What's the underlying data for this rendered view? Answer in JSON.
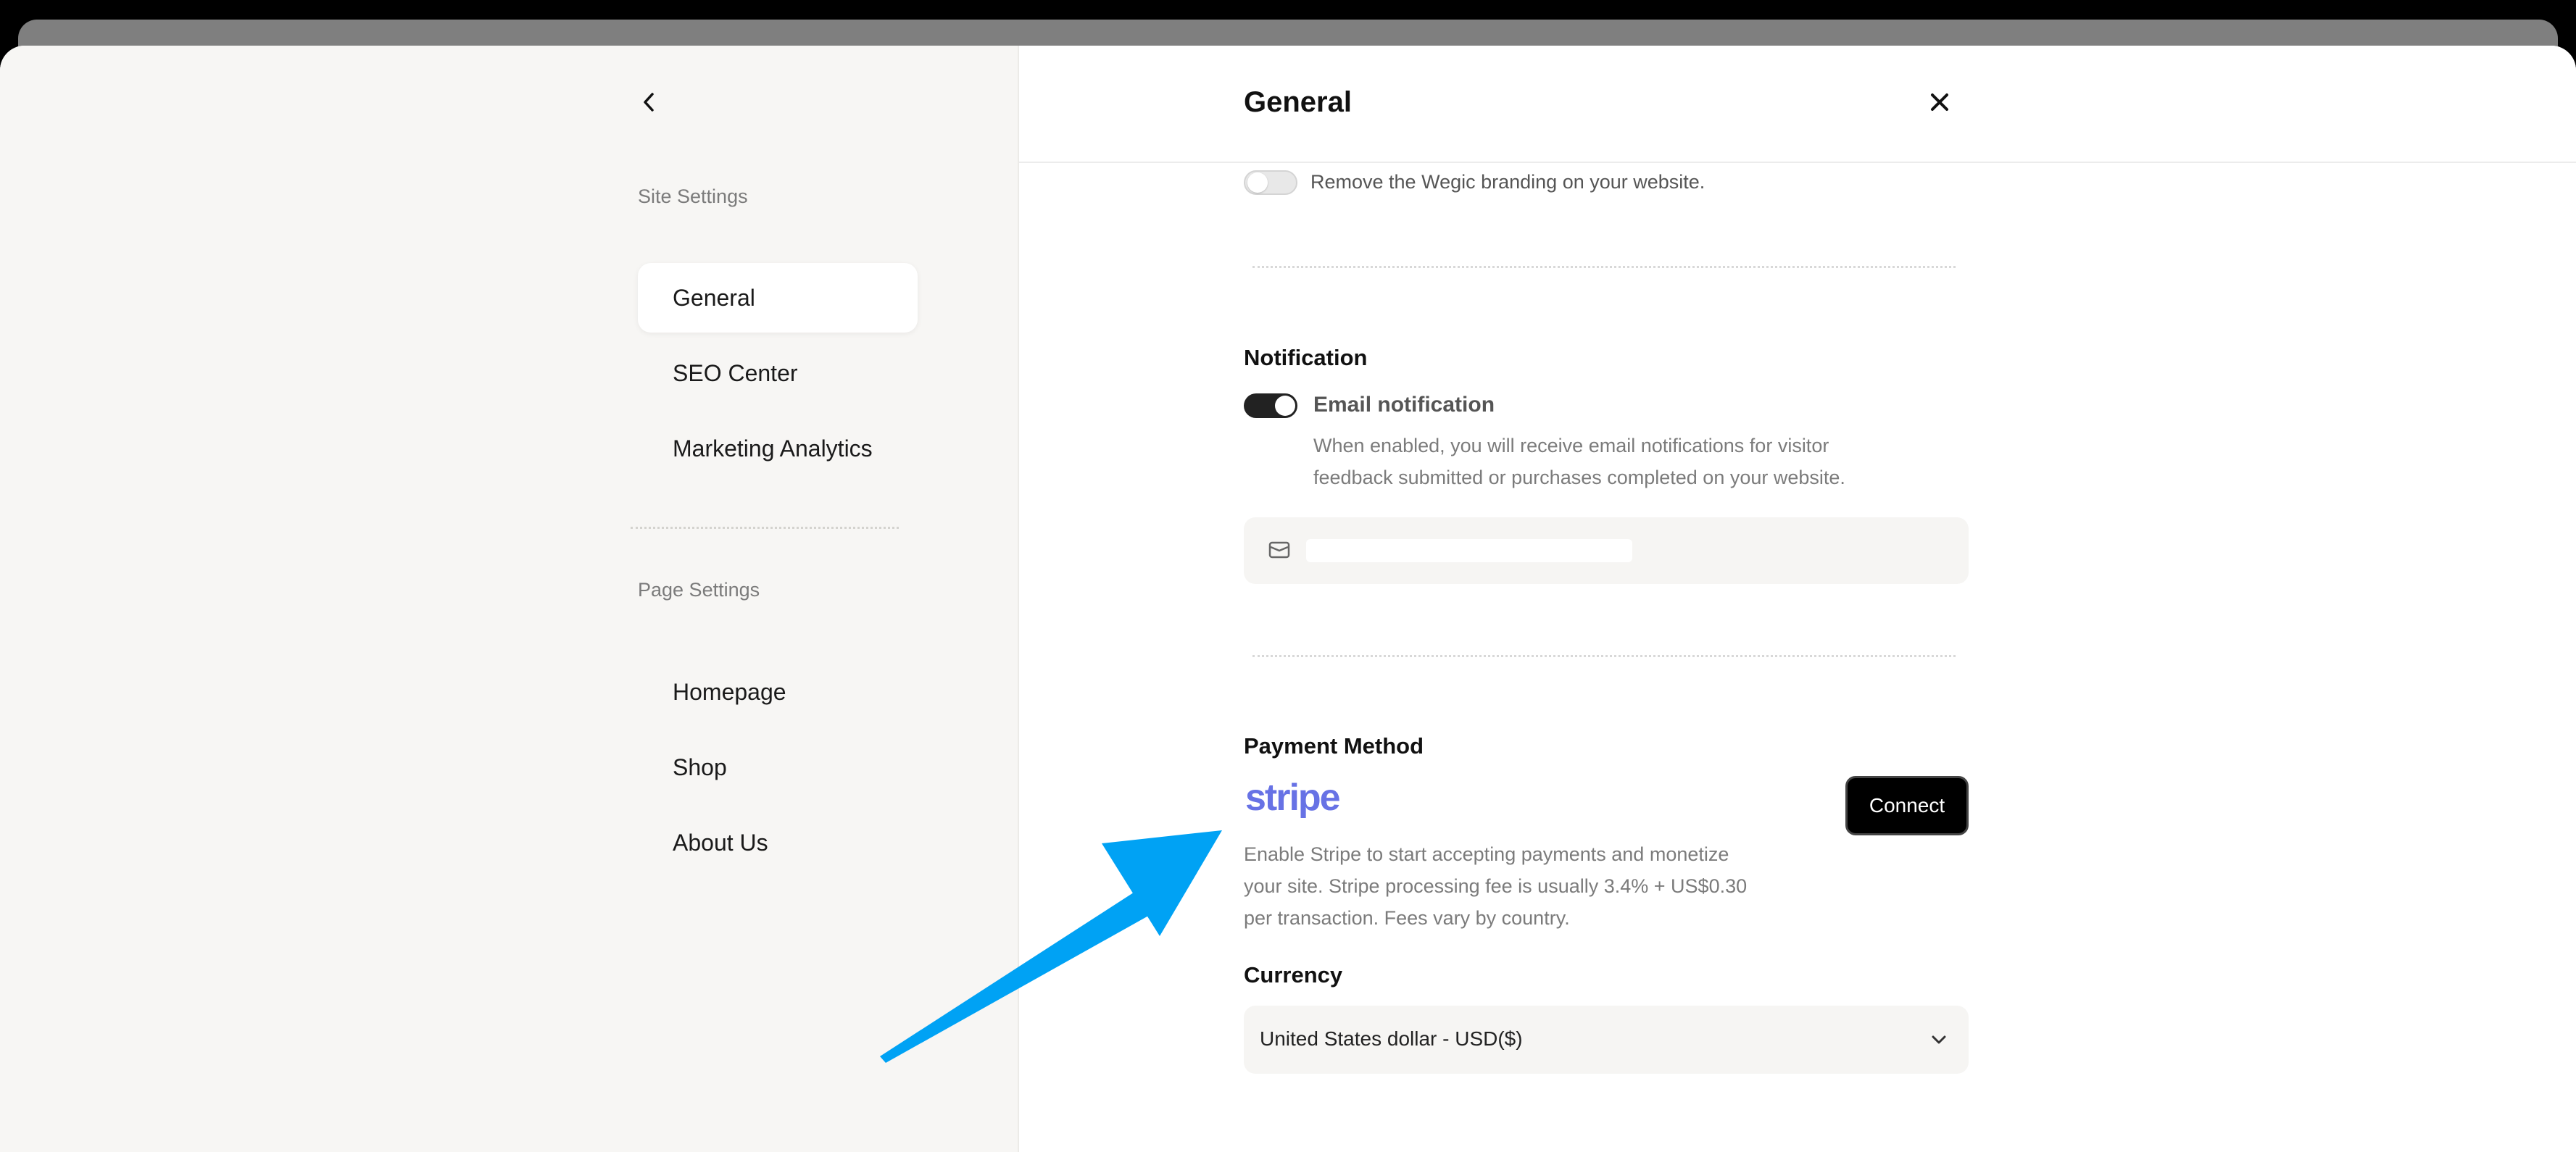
{
  "sidebar": {
    "back_icon": "chevron-left-icon",
    "site_settings_label": "Site Settings",
    "site_items": [
      {
        "label": "General",
        "active": true
      },
      {
        "label": "SEO Center",
        "active": false
      },
      {
        "label": "Marketing Analytics",
        "active": false
      }
    ],
    "page_settings_label": "Page Settings",
    "page_items": [
      {
        "label": "Homepage"
      },
      {
        "label": "Shop"
      },
      {
        "label": "About Us"
      }
    ]
  },
  "header": {
    "title": "General",
    "close_icon": "close-icon"
  },
  "branding": {
    "toggle_on": false,
    "text": "Remove the Wegic branding on your website."
  },
  "notification": {
    "heading": "Notification",
    "toggle_on": true,
    "label": "Email notification",
    "description_line1": "When enabled, you will receive email notifications for visitor",
    "description_line2": "feedback submitted or purchases completed on your website.",
    "email_icon": "mail-icon",
    "email_value": ""
  },
  "payment": {
    "heading": "Payment Method",
    "provider_logo": "stripe",
    "connect_label": "Connect",
    "description_line1": "Enable Stripe to start accepting payments and monetize",
    "description_line2": "your site. Stripe processing fee is usually 3.4% + US$0.30",
    "description_line3": "per transaction. Fees vary by country."
  },
  "currency": {
    "heading": "Currency",
    "selected": "United States dollar - USD($)",
    "dropdown_icon": "chevron-down-icon"
  },
  "annotation": {
    "arrow_color": "#00a2f4"
  },
  "colors": {
    "stripe_brand": "#6772e5",
    "sidebar_bg": "#f7f6f4",
    "accent_dark": "#000000"
  }
}
